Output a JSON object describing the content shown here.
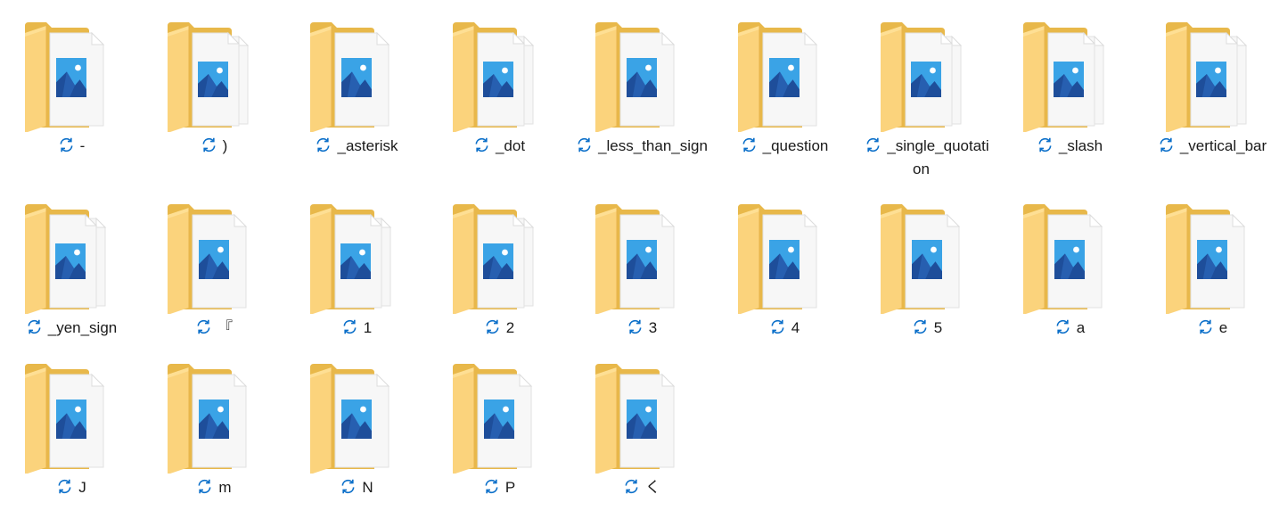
{
  "folders": [
    {
      "name": "-",
      "multi": false
    },
    {
      "name": ")",
      "multi": true
    },
    {
      "name": "_asterisk",
      "multi": false
    },
    {
      "name": "_dot",
      "multi": true
    },
    {
      "name": "_less_than_sign",
      "multi": false
    },
    {
      "name": "_question",
      "multi": false
    },
    {
      "name": "_single_quotati",
      "name_cont": "on",
      "multi": true
    },
    {
      "name": "_slash",
      "multi": true
    },
    {
      "name": "_vertical_bar",
      "multi": true
    },
    {
      "name": "_yen_sign",
      "multi": true
    },
    {
      "name": "『",
      "multi": false
    },
    {
      "name": "1",
      "multi": true
    },
    {
      "name": "2",
      "multi": true
    },
    {
      "name": "3",
      "multi": false
    },
    {
      "name": "4",
      "multi": false
    },
    {
      "name": "5",
      "multi": false
    },
    {
      "name": "a",
      "multi": false
    },
    {
      "name": "e",
      "multi": false
    },
    {
      "name": "J",
      "multi": false
    },
    {
      "name": "m",
      "multi": false
    },
    {
      "name": "N",
      "multi": false
    },
    {
      "name": "P",
      "multi": false
    },
    {
      "name": "く",
      "multi": false
    }
  ],
  "icons": {
    "folder": "folder-icon",
    "status": "sync-pending-icon"
  },
  "colors": {
    "folder_back": "#e8b84a",
    "folder_front": "#fbd37c",
    "folder_light": "#ffe29a",
    "paper": "#f7f7f7",
    "photo_sky": "#3aa3e6",
    "photo_mountain": "#1e4e9a",
    "sync_blue": "#0b6fc9"
  }
}
